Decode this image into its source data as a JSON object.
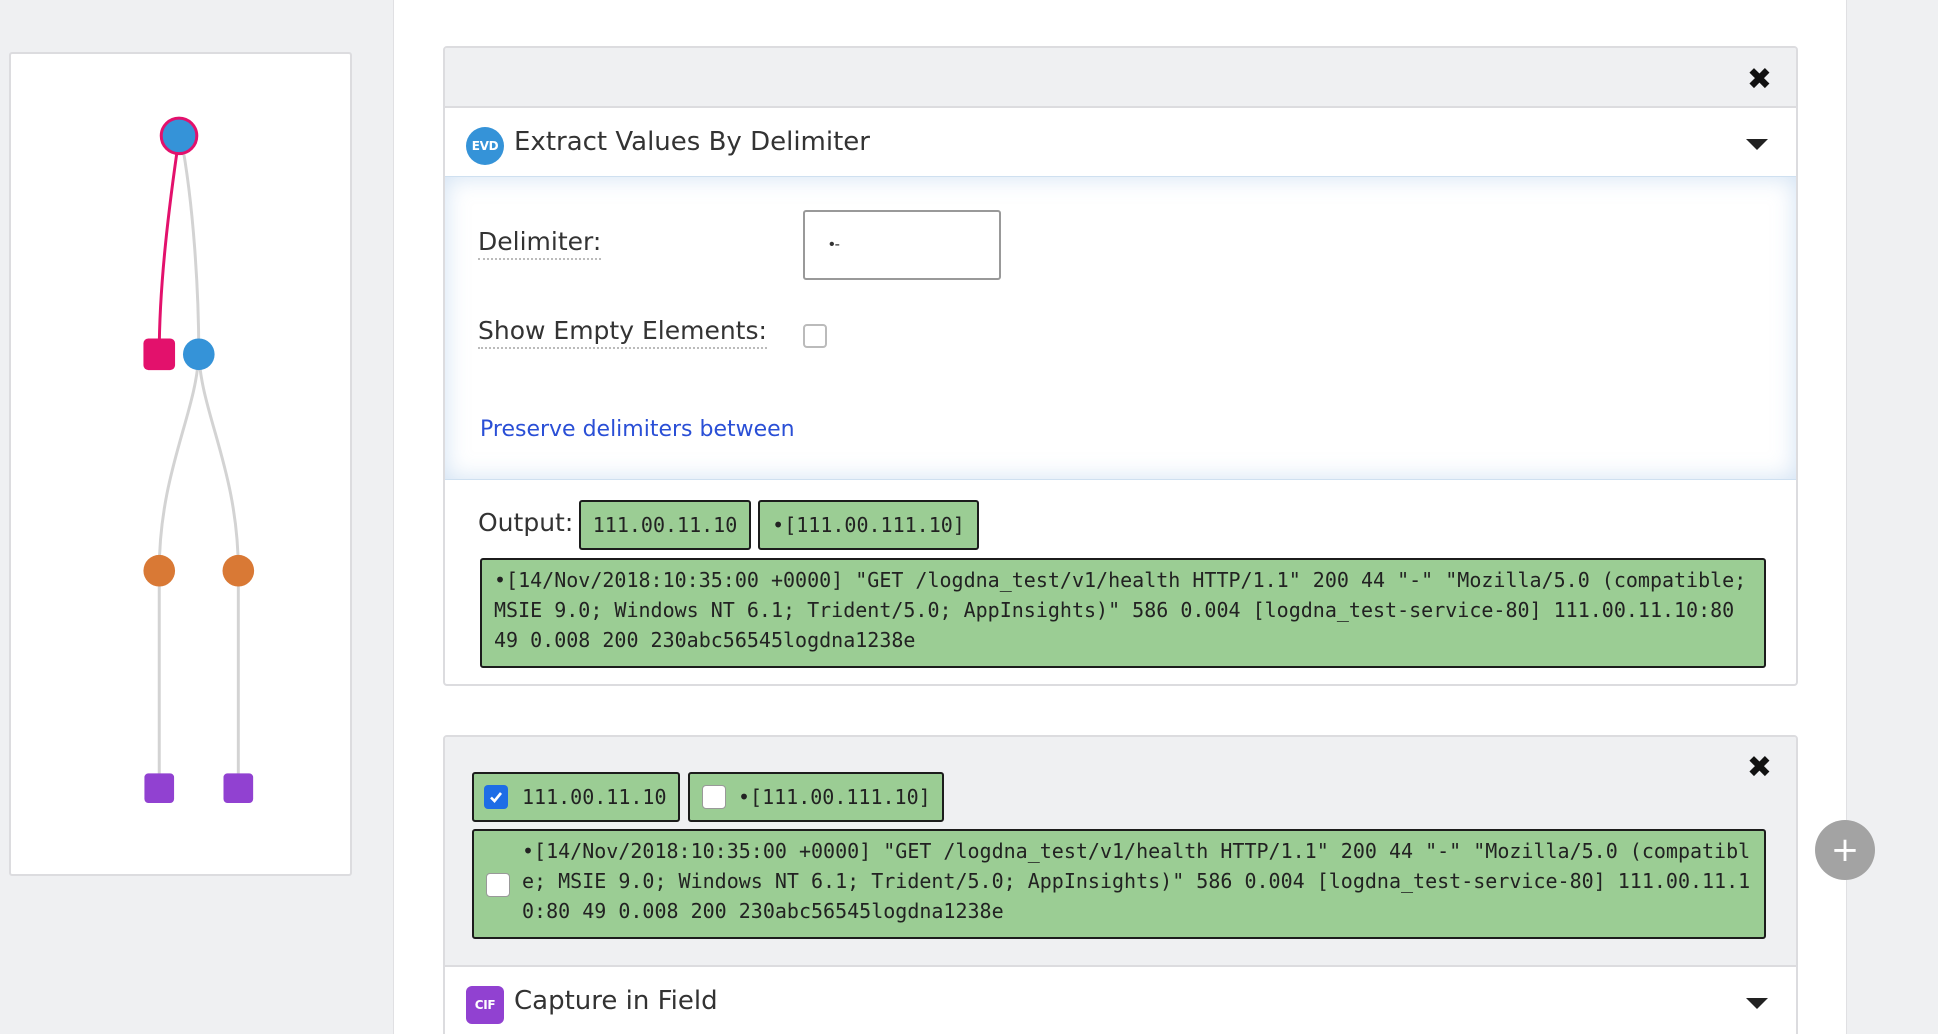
{
  "pipeline_graph": {
    "node_colors": {
      "blue": "#3593d8",
      "pink": "#e3116c",
      "orange": "#d97935",
      "purple": "#9141d1",
      "edge": "#d3d3d3"
    }
  },
  "evd_card": {
    "close_icon": "close-icon",
    "badge": "EVD",
    "title": "Extract Values By Delimiter",
    "delimiter_label": "Delimiter:",
    "delimiter_value": "•-",
    "show_empty_label": "Show Empty Elements:",
    "show_empty_checked": false,
    "preserve_link": "Preserve delimiters between",
    "output_label": "Output:",
    "outputs": [
      "111.00.11.10",
      "•[111.00.111.10]",
      "•[14/Nov/2018:10:35:00 +0000] \"GET /logdna_test/v1/health HTTP/1.1\" 200 44 \"-\" \"Mozilla/5.0 (compatible; MSIE 9.0; Windows NT 6.1; Trident/5.0; AppInsights)\" 586 0.004 [logdna_test-service-80] 111.00.11.10:80 49 0.008 200 230abc56545logdna1238e"
    ]
  },
  "cif_card": {
    "close_icon": "close-icon",
    "selections": [
      {
        "value": "111.00.11.10",
        "checked": true
      },
      {
        "value": "•[111.00.111.10]",
        "checked": false
      },
      {
        "value": "•[14/Nov/2018:10:35:00 +0000] \"GET /logdna_test/v1/health HTTP/1.1\" 200 44 \"-\" \"Mozilla/5.0 (compatible; MSIE 9.0; Windows NT 6.1; Trident/5.0; AppInsights)\" 586 0.004 [logdna_test-service-80] 111.00.11.10:80 49 0.008 200 230abc56545logdna1238e",
        "checked": false
      }
    ],
    "badge": "CIF",
    "title": "Capture in Field"
  },
  "add_button": "+"
}
